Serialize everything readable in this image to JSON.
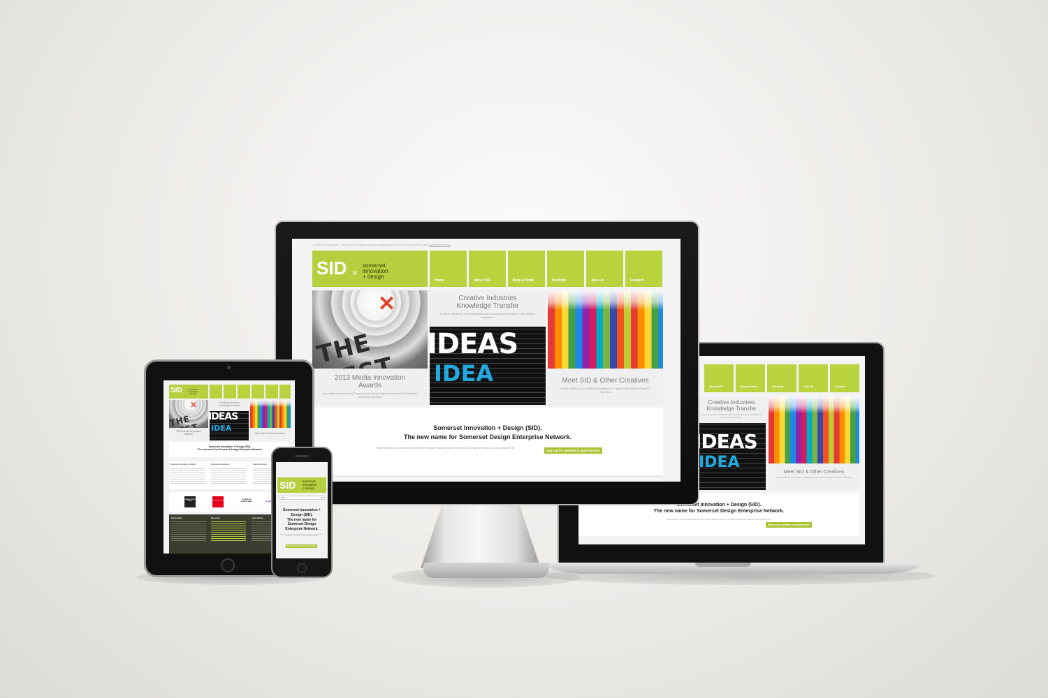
{
  "site": {
    "topbar_text": "Somerset Innovation + Design is a designer-support organisation for the design sector by the",
    "topbar_link": "Somerset County",
    "logo": "SID",
    "logo_mark": "®",
    "tagline_1": "somerset",
    "tagline_2": "innovation",
    "tagline_3": "+ design",
    "nav": [
      "Home",
      "About SID",
      "Blog & News",
      "Portfolio",
      "Join Us",
      "Contact"
    ],
    "tile_cik_title_1": "Creative Industries",
    "tile_cik_title_2": "Knowledge Transfer",
    "tile_cik_text": "Creative Industries KTN stimulates and encourages innovation in the creative industries.",
    "tile_award_title_1": "2013 Media Innovation",
    "tile_award_title_2": "Awards",
    "tile_award_text": "Innovative companies in Somerset are being invited to enter the 2013 Media Innovation Awards.",
    "tile_meet_title": "Meet SID & Other Creatives",
    "tile_meet_text": "Social meetups for Somerset Designers & Creative Industries in Yeovil & Taunton.",
    "image_best": "THE BEST",
    "image_ideas": "IDEAS",
    "image_idea": "IDEA",
    "banner_line_1": "Somerset Innovation + Design (SID).",
    "banner_line_2": "The new name for Somerset Design Enterprise Network.",
    "banner_text": "Representing and promoting Somerset's design industry and it's members at regional, national, and global level.",
    "signup_button": "Sign up for updates & opportunities"
  },
  "phone": {
    "menu_label": "Menu",
    "banner_line_1": "Somerset Innovation +",
    "banner_line_2": "Design (SID).",
    "banner_line_3": "The new name for",
    "banner_line_4": "Somerset Design",
    "banner_line_5": "Enterprise Network."
  },
  "tablet": {
    "col_1": "Somerset Innovation + Design",
    "col_2": "Business & Education",
    "col_3": "Getting Involved",
    "logo_1": "DESIGN SOUTH WEST",
    "logo_2": "Design Council",
    "logo_3": "creative & cultural skills",
    "logo_4": "creative england",
    "footer_1": "Get Involved",
    "footer_2": "Resources",
    "footer_3": "Latest Tweets"
  },
  "colors": {
    "accent": "#b5cf3e",
    "accent_dark": "#a8c334",
    "tile_grey": "#efefef",
    "device_black": "#111111"
  }
}
